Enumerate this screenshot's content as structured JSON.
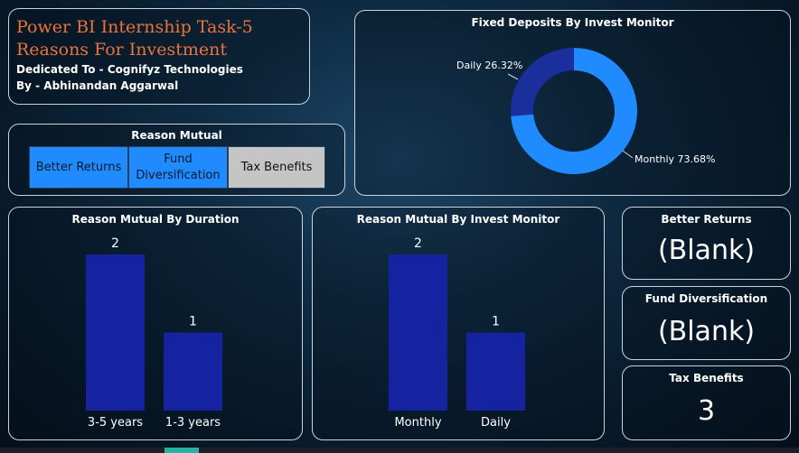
{
  "header": {
    "title_line1": "Power BI Internship Task-5",
    "title_line2": "Reasons For Investment",
    "dedicated": "Dedicated To - Cognifyz Technologies",
    "author": "By - Abhinandan Aggarwal"
  },
  "slicer": {
    "title": "Reason Mutual",
    "options": [
      {
        "label": "Better Returns",
        "selected": true
      },
      {
        "label": "Fund Diversification",
        "selected": true
      },
      {
        "label": "Tax Benefits",
        "selected": false
      }
    ]
  },
  "kpis": [
    {
      "title": "Better Returns",
      "value": "(Blank)"
    },
    {
      "title": "Fund Diversification",
      "value": "(Blank)"
    },
    {
      "title": "Tax Benefits",
      "value": "3"
    }
  ],
  "colors": {
    "accent": "#1f8bff",
    "bar": "#1523a0",
    "title": "#e8743b",
    "donut_dark": "#1a2e9c",
    "donut_light": "#1f8bff"
  },
  "chart_data": [
    {
      "type": "pie",
      "title": "Fixed Deposits By Invest Monitor",
      "categories": [
        "Daily",
        "Monthly"
      ],
      "values": [
        26.32,
        73.68
      ],
      "labels": [
        "Daily 26.32%",
        "Monthly 73.68%"
      ],
      "donut": true
    },
    {
      "type": "bar",
      "title": "Reason Mutual By Duration",
      "categories": [
        "3-5 years",
        "1-3 years"
      ],
      "values": [
        2,
        1
      ],
      "ylim": [
        0,
        2
      ]
    },
    {
      "type": "bar",
      "title": "Reason Mutual By Invest Monitor",
      "categories": [
        "Monthly",
        "Daily"
      ],
      "values": [
        2,
        1
      ],
      "ylim": [
        0,
        2
      ]
    }
  ]
}
